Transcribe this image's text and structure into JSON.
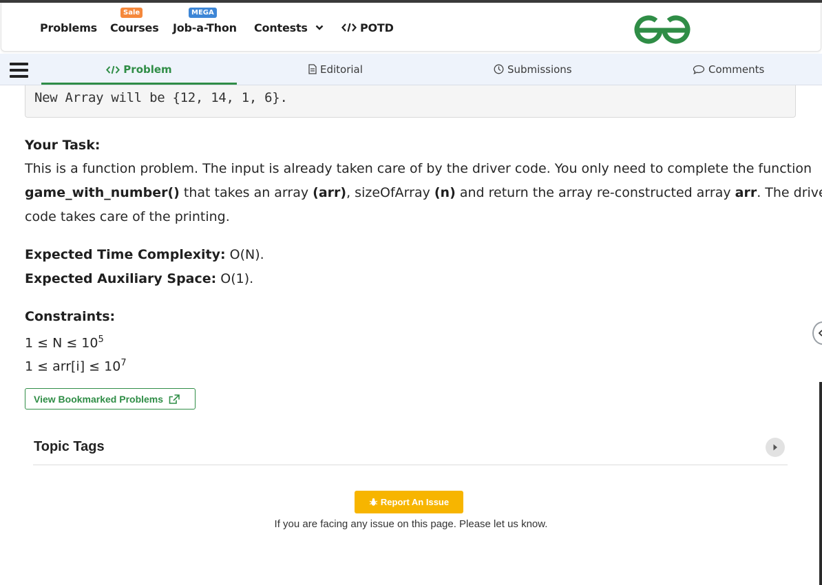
{
  "nav": {
    "problems": "Problems",
    "courses": "Courses",
    "courses_badge": "Sale",
    "jobathon": "Job-a-Thon",
    "jobathon_badge": "MEGA",
    "contests": "Contests",
    "potd": "POTD",
    "colors": {
      "sale_badge": "#f5883b",
      "mega_badge": "#3d86d6",
      "brand_green": "#2f8d46"
    }
  },
  "tabs": [
    {
      "label": "Problem",
      "icon": "code-icon",
      "active": true
    },
    {
      "label": "Editorial",
      "icon": "document-icon"
    },
    {
      "label": "Submissions",
      "icon": "clock-icon"
    },
    {
      "label": "Comments",
      "icon": "comment-icon"
    }
  ],
  "example": {
    "text": "New Array will be {12, 14, 1, 6}."
  },
  "task": {
    "heading": "Your Task:",
    "line1": "This is a function problem. The input is already taken care of by the driver code. You only need to complete the function",
    "fn_name": "game_with_number()",
    "mid1": " that takes an array ",
    "arr_bold": "(arr)",
    "mid2": ", sizeOfArray ",
    "n_bold": "(n)",
    "mid3": " and return the array re-constructed array ",
    "arr2_bold": "arr",
    "mid4": ". The driver",
    "line3": "code takes care of the printing."
  },
  "complexity": {
    "time_label": "Expected Time Complexity:",
    "time_value": " O(N).",
    "space_label": "Expected Auxiliary Space:",
    "space_value": " O(1)."
  },
  "constraints": {
    "heading": "Constraints:",
    "c1_base": "1 ≤ N ≤ 10",
    "c1_exp": "5",
    "c2_base": "1 ≤ arr[i] ≤ 10",
    "c2_exp": "7"
  },
  "bookmark_button": "View Bookmarked Problems",
  "topic_tags": "Topic Tags",
  "report": {
    "button": "Report An Issue",
    "text": "If you are facing any issue on this page. Please let us know."
  }
}
